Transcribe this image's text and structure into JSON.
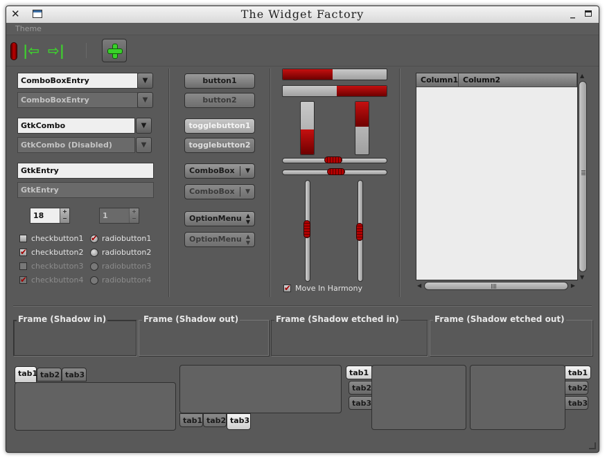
{
  "window": {
    "title": "The Widget Factory"
  },
  "menubar": {
    "theme": "Theme"
  },
  "column1": {
    "combo_entry_1": "ComboBoxEntry",
    "combo_entry_2": "ComboBoxEntry",
    "gtk_combo_1": "GtkCombo",
    "gtk_combo_2": "GtkCombo (Disabled)",
    "entry_1": "GtkEntry",
    "entry_2": "GtkEntry",
    "spin_1": "18",
    "spin_2": "1",
    "checks": [
      "checkbutton1",
      "checkbutton2",
      "checkbutton3",
      "checkbutton4"
    ],
    "radios": [
      "radiobutton1",
      "radiobutton2",
      "radiobutton3",
      "radiobutton4"
    ]
  },
  "column2": {
    "button1": "button1",
    "button2": "button2",
    "toggle1": "togglebutton1",
    "toggle2": "togglebutton2",
    "combobox1": "ComboBox",
    "combobox2": "ComboBox",
    "option1": "OptionMenu",
    "option2": "OptionMenu"
  },
  "column3": {
    "move_in_harmony": "Move In Harmony",
    "progress_h1": 0.48,
    "progress_h2": 0.48,
    "progress_v1": 0.48,
    "progress_v2": 0.48
  },
  "tree": {
    "col1": "Column1",
    "col2": "Column2"
  },
  "frames": {
    "in": "Frame (Shadow in)",
    "out": "Frame (Shadow out)",
    "etched_in": "Frame (Shadow etched in)",
    "etched_out": "Frame (Shadow etched out)"
  },
  "notebooks": {
    "tabs": [
      "tab1",
      "tab2",
      "tab3"
    ]
  },
  "colors": {
    "accent": "#b30000",
    "window_bg": "#595959",
    "plus": "#39d12a"
  },
  "icons": [
    "close-icon",
    "window-menu-icon",
    "minimize-icon",
    "maximize-icon",
    "back-arrow-icon",
    "forward-arrow-icon",
    "add-icon"
  ]
}
